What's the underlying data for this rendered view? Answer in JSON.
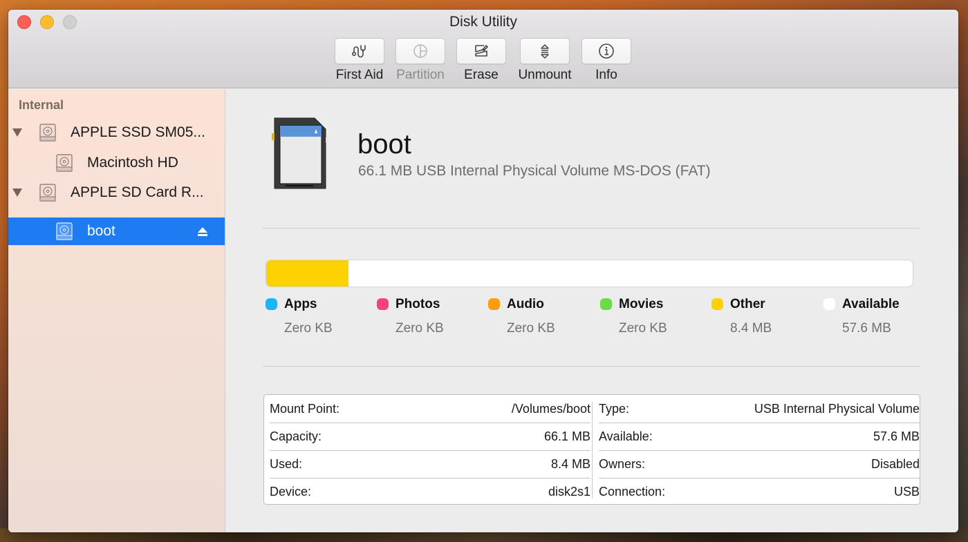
{
  "window": {
    "title": "Disk Utility",
    "traffic_lights": [
      "close",
      "minimize",
      "zoom"
    ]
  },
  "toolbar": {
    "buttons": [
      {
        "label": "First Aid",
        "icon": "stethoscope-icon",
        "enabled": true
      },
      {
        "label": "Partition",
        "icon": "pie-chart-icon",
        "enabled": false
      },
      {
        "label": "Erase",
        "icon": "erase-icon",
        "enabled": true
      },
      {
        "label": "Unmount",
        "icon": "unmount-icon",
        "enabled": true
      },
      {
        "label": "Info",
        "icon": "info-icon",
        "enabled": true
      }
    ]
  },
  "sidebar": {
    "section": "Internal",
    "items": [
      {
        "label": "APPLE SSD SM05...",
        "level": 0,
        "expanded": true,
        "icon": "hard-drive-icon"
      },
      {
        "label": "Macintosh HD",
        "level": 1,
        "icon": "hard-drive-icon"
      },
      {
        "label": "APPLE SD Card R...",
        "level": 0,
        "expanded": true,
        "icon": "hard-drive-icon"
      },
      {
        "label": "boot",
        "level": 1,
        "selected": true,
        "icon": "hard-drive-icon",
        "eject": true
      }
    ]
  },
  "volume": {
    "name": "boot",
    "description": "66.1 MB USB Internal Physical Volume MS-DOS (FAT)",
    "icon": "sd-card-icon"
  },
  "usage": {
    "used_fraction": 0.127,
    "colors": {
      "apps": "#1ab4f7",
      "photos": "#f4427a",
      "audio": "#fd9c10",
      "movies": "#6cdb4a",
      "other": "#fed100",
      "available": "#ffffff"
    },
    "legend": [
      {
        "key": "apps",
        "label": "Apps",
        "value": "Zero KB"
      },
      {
        "key": "photos",
        "label": "Photos",
        "value": "Zero KB"
      },
      {
        "key": "audio",
        "label": "Audio",
        "value": "Zero KB"
      },
      {
        "key": "movies",
        "label": "Movies",
        "value": "Zero KB"
      },
      {
        "key": "other",
        "label": "Other",
        "value": "8.4 MB"
      },
      {
        "key": "available",
        "label": "Available",
        "value": "57.6 MB"
      }
    ]
  },
  "info": {
    "left": [
      {
        "label": "Mount Point:",
        "value": "/Volumes/boot"
      },
      {
        "label": "Capacity:",
        "value": "66.1 MB"
      },
      {
        "label": "Used:",
        "value": "8.4 MB"
      },
      {
        "label": "Device:",
        "value": "disk2s1"
      }
    ],
    "right": [
      {
        "label": "Type:",
        "value": "USB Internal Physical Volume"
      },
      {
        "label": "Available:",
        "value": "57.6 MB"
      },
      {
        "label": "Owners:",
        "value": "Disabled"
      },
      {
        "label": "Connection:",
        "value": "USB"
      }
    ]
  }
}
